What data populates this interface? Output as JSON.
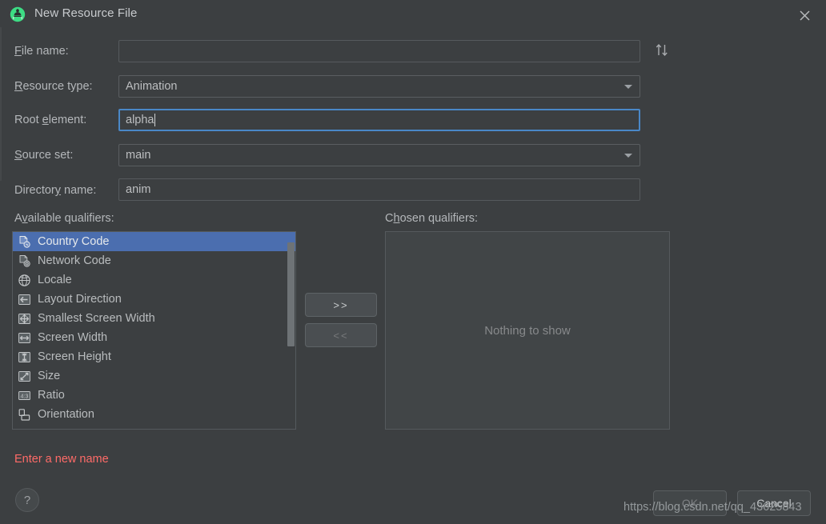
{
  "window": {
    "title": "New Resource File",
    "app_icon": "android-studio-icon",
    "close_icon": "close-icon"
  },
  "form": {
    "file_name": {
      "label": "File name:",
      "mnemonic": "F",
      "value": "",
      "placeholder": ""
    },
    "swap_icon": "sort-swap-icon",
    "resource_type": {
      "label": "Resource type:",
      "mnemonic": "R",
      "value": "Animation",
      "options": [
        "Animation"
      ]
    },
    "root_element": {
      "label": "Root element:",
      "mnemonic": "e",
      "value": "alpha",
      "focused": true
    },
    "source_set": {
      "label": "Source set:",
      "mnemonic": "S",
      "value": "main",
      "options": [
        "main"
      ]
    },
    "directory_name": {
      "label": "Directory name:",
      "mnemonic": "y",
      "value": "anim"
    }
  },
  "qualifiers": {
    "available_label": "Available qualifiers:",
    "available_mnemonic": "v",
    "chosen_label": "Chosen qualifiers:",
    "chosen_mnemonic": "h",
    "available_items": [
      {
        "label": "Country Code",
        "icon": "country-code-icon",
        "selected": true
      },
      {
        "label": "Network Code",
        "icon": "network-code-icon",
        "selected": false
      },
      {
        "label": "Locale",
        "icon": "locale-globe-icon",
        "selected": false
      },
      {
        "label": "Layout Direction",
        "icon": "layout-direction-icon",
        "selected": false
      },
      {
        "label": "Smallest Screen Width",
        "icon": "smallest-screen-width-icon",
        "selected": false
      },
      {
        "label": "Screen Width",
        "icon": "screen-width-icon",
        "selected": false
      },
      {
        "label": "Screen Height",
        "icon": "screen-height-icon",
        "selected": false
      },
      {
        "label": "Size",
        "icon": "size-icon",
        "selected": false
      },
      {
        "label": "Ratio",
        "icon": "ratio-icon",
        "selected": false
      },
      {
        "label": "Orientation",
        "icon": "orientation-icon",
        "selected": false
      }
    ],
    "chosen_empty_text": "Nothing to show",
    "add_button": ">>",
    "remove_button": "<<"
  },
  "footer": {
    "error_message": "Enter a new name",
    "help_label": "?",
    "ok_label": "OK",
    "cancel_label": "Cancel",
    "watermark": "https://blog.csdn.net/qq_43625843"
  },
  "colors": {
    "dialog_bg": "#3C3F41",
    "selection_blue": "#4B6EAF",
    "focus_border": "#4A88C7",
    "error_red": "#FF6B68",
    "android_green": "#3DDC84"
  }
}
